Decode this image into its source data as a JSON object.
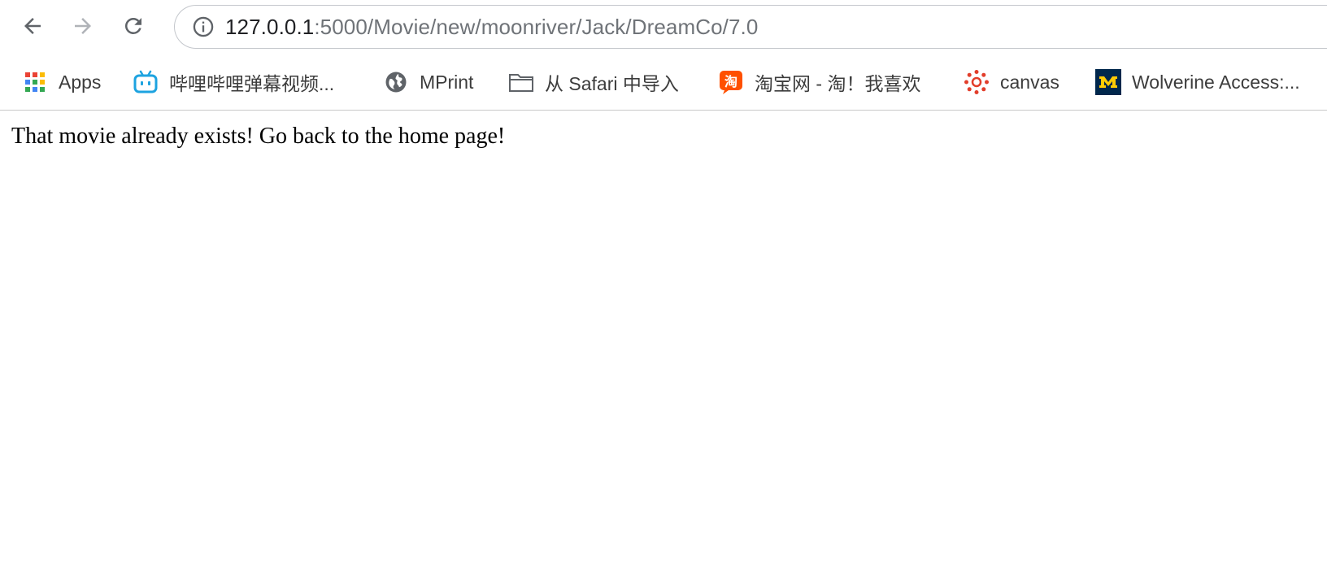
{
  "toolbar": {
    "back_icon": "back-arrow-icon",
    "forward_icon": "forward-arrow-icon",
    "reload_icon": "reload-icon"
  },
  "omnibox": {
    "info_icon": "info-icon",
    "url_host": "127.0.0.1",
    "url_path": ":5000/Movie/new/moonriver/Jack/DreamCo/7.0"
  },
  "bookmarks": [
    {
      "label": "Apps",
      "icon": "apps-grid-icon"
    },
    {
      "label": "哔哩哔哩弹幕视频...",
      "icon": "bilibili-icon"
    },
    {
      "label": "MPrint",
      "icon": "globe-icon"
    },
    {
      "label": "从 Safari 中导入",
      "icon": "folder-icon"
    },
    {
      "label": "淘宝网 - 淘！我喜欢",
      "icon": "taobao-icon"
    },
    {
      "label": "canvas",
      "icon": "canvas-icon"
    },
    {
      "label": "Wolverine Access:...",
      "icon": "michigan-m-icon"
    }
  ],
  "page": {
    "message": "That movie already exists! Go back to the home page!"
  },
  "colors": {
    "bilibili": "#1da3e0",
    "taobao": "#ff5000",
    "canvas": "#e23e2b",
    "michigan_blue": "#00274c",
    "michigan_maize": "#ffcb05"
  }
}
